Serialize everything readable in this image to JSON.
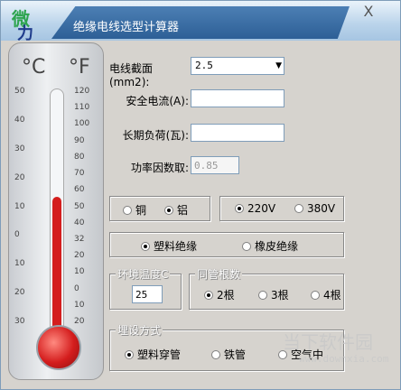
{
  "window": {
    "title": "绝缘电线选型计算器",
    "logo": [
      "微",
      "力"
    ],
    "close_glyph": "X"
  },
  "thermometer": {
    "celsius_unit": "°C",
    "fahrenheit_unit": "°F",
    "celsius_ticks": [
      "50",
      "40",
      "30",
      "20",
      "10",
      "0",
      "10",
      "20",
      "30"
    ],
    "fahrenheit_ticks": [
      "120",
      "110",
      "100",
      "90",
      "80",
      "70",
      "60",
      "50",
      "40",
      "32",
      "20",
      "10",
      "0",
      "10",
      "20"
    ],
    "level": 0.6
  },
  "form": {
    "cross_section_label": "电线截面(mm2):",
    "cross_section_value": "2.5",
    "current_label": "安全电流(A):",
    "current_value": "",
    "load_label": "长期负荷(瓦):",
    "load_value": "",
    "power_factor_label": "功率因数取:",
    "power_factor_value": "0.85"
  },
  "material": {
    "options": [
      "铜",
      "铝"
    ],
    "selected": 1
  },
  "voltage": {
    "options": [
      "220V",
      "380V"
    ],
    "selected": 0
  },
  "insulation": {
    "options": [
      "塑料绝缘",
      "橡皮绝缘"
    ],
    "selected": 0
  },
  "temperature": {
    "legend": "环境温度C",
    "value": "25"
  },
  "conduit": {
    "legend": "同管根数",
    "options": [
      "2根",
      "3根",
      "4根"
    ],
    "selected": 0
  },
  "laying": {
    "legend": "埋设方式",
    "options": [
      "塑料穿管",
      "铁管",
      "空气中"
    ],
    "selected": 0
  },
  "watermark": {
    "text": "当下软件园",
    "url": "www.downxia.com"
  }
}
